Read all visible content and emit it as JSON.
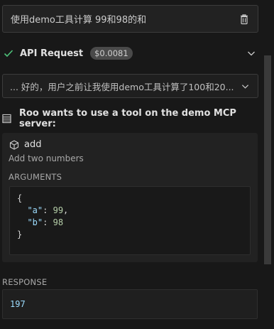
{
  "user_message": {
    "text": "使用demo工具计算 99和98的和"
  },
  "api_request": {
    "title": "API Request",
    "cost": "$0.0081"
  },
  "reasoning": {
    "text": "... 好的，用户之前让我使用demo工具计算了100和20..."
  },
  "tool_use": {
    "header": "Roo wants to use a tool on the demo MCP server:",
    "tool_name": "add",
    "description": "Add two numbers",
    "arguments_label": "ARGUMENTS",
    "arguments": {
      "open": "{",
      "close": "}",
      "a_key": "\"a\"",
      "a_value": "99",
      "b_key": "\"b\"",
      "b_value": "98"
    }
  },
  "response": {
    "label": "RESPONSE",
    "value": "197"
  },
  "colors": {
    "success_check": "#4ec27a",
    "json_key": "#9cdcfe",
    "json_number": "#b5cea8",
    "background": "#181818"
  },
  "icons": {
    "delete": "trash-icon",
    "status": "check-icon",
    "expand": "chevron-down-icon",
    "server": "server-icon",
    "tool": "cube-icon"
  }
}
